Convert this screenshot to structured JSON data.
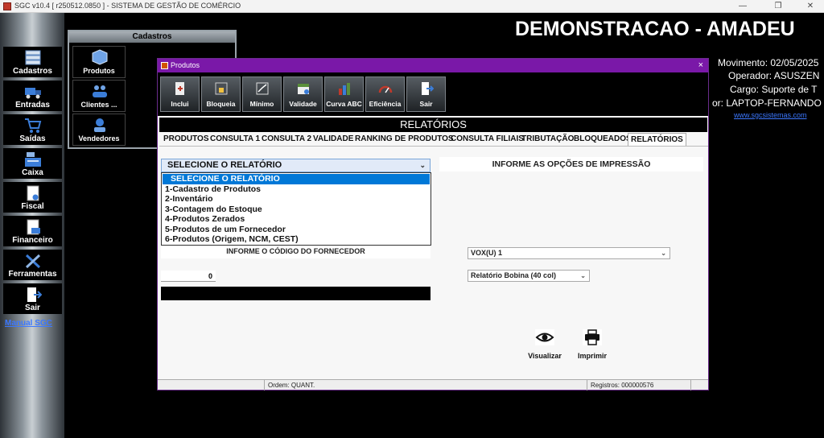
{
  "window": {
    "title": "SGC v10.4 [ r250512.0850 ] - SISTEMA DE GESTÃO DE COMÉRCIO"
  },
  "sidebar": {
    "items": [
      {
        "label": "Cadastros",
        "icon": "database-icon"
      },
      {
        "label": "Entradas",
        "icon": "truck-icon"
      },
      {
        "label": "Saídas",
        "icon": "cart-icon"
      },
      {
        "label": "Caixa",
        "icon": "cash-register-icon"
      },
      {
        "label": "Fiscal",
        "icon": "document-icon"
      },
      {
        "label": "Financeiro",
        "icon": "money-document-icon"
      },
      {
        "label": "Ferramentas",
        "icon": "tools-icon"
      },
      {
        "label": "Sair",
        "icon": "exit-door-icon"
      }
    ],
    "manual_link": "Manual SGC"
  },
  "cadastros_panel": {
    "title": "Cadastros",
    "items": [
      {
        "label": "Produtos",
        "icon": "box-icon"
      },
      {
        "label": "Clientes ...",
        "icon": "people-icon"
      },
      {
        "label": "Vendedores",
        "icon": "person-helmet-icon"
      }
    ]
  },
  "header": {
    "company": "DEMONSTRACAO - AMADEU",
    "movimento": "Movimento: 02/05/2025",
    "operador": "Operador: ASUSZEN",
    "cargo": "Cargo: Suporte de T",
    "computador": "or: LAPTOP-FERNANDO",
    "website": "www.sgcsistemas.com"
  },
  "dialog": {
    "title": "Produtos",
    "close": "×",
    "toolbar": [
      {
        "label": "Inclui",
        "icon": "add-document-icon"
      },
      {
        "label": "Bloqueia",
        "icon": "lock-book-icon"
      },
      {
        "label": "Mínimo",
        "icon": "minimum-chart-icon"
      },
      {
        "label": "Validade",
        "icon": "calendar-icon"
      },
      {
        "label": "Curva ABC",
        "icon": "bar-chart-icon"
      },
      {
        "label": "Eficiência",
        "icon": "gauge-icon"
      },
      {
        "label": "Sair",
        "icon": "exit-door-icon"
      }
    ],
    "section_title": "RELATÓRIOS",
    "tabs": [
      "PRODUTOS",
      "CONSULTA 1",
      "CONSULTA 2",
      "VALIDADE",
      "RANKING DE PRODUTOS",
      "CONSULTA FILIAIS",
      "TRIBUTAÇÃO",
      "BLOQUEADOS",
      "RELATÓRIOS"
    ],
    "active_tab": "RELATÓRIOS",
    "report_select": {
      "value": "SELECIONE O RELATÓRIO",
      "options": [
        "SELECIONE O RELATÓRIO",
        "1-Cadastro de Produtos",
        "2-Inventário",
        "3-Contagem do Estoque",
        "4-Produtos Zerados",
        "5-Produtos de um Fornecedor",
        "6-Produtos (Origem, NCM, CEST)"
      ]
    },
    "print_options_title": "INFORME AS OPÇÕES DE IMPRESSÃO",
    "fornecedor_label": "INFORME O CÓDIGO DO FORNECEDOR",
    "fornecedor_code": "0",
    "printer_select": "VOX(U) 1",
    "format_select": "Relatório Bobina (40 col)",
    "visualizar_label": "Visualizar",
    "imprimir_label": "Imprimir",
    "status": {
      "ordem": "Ordem: QUANT.",
      "registros": "Registros: 000000576"
    }
  }
}
